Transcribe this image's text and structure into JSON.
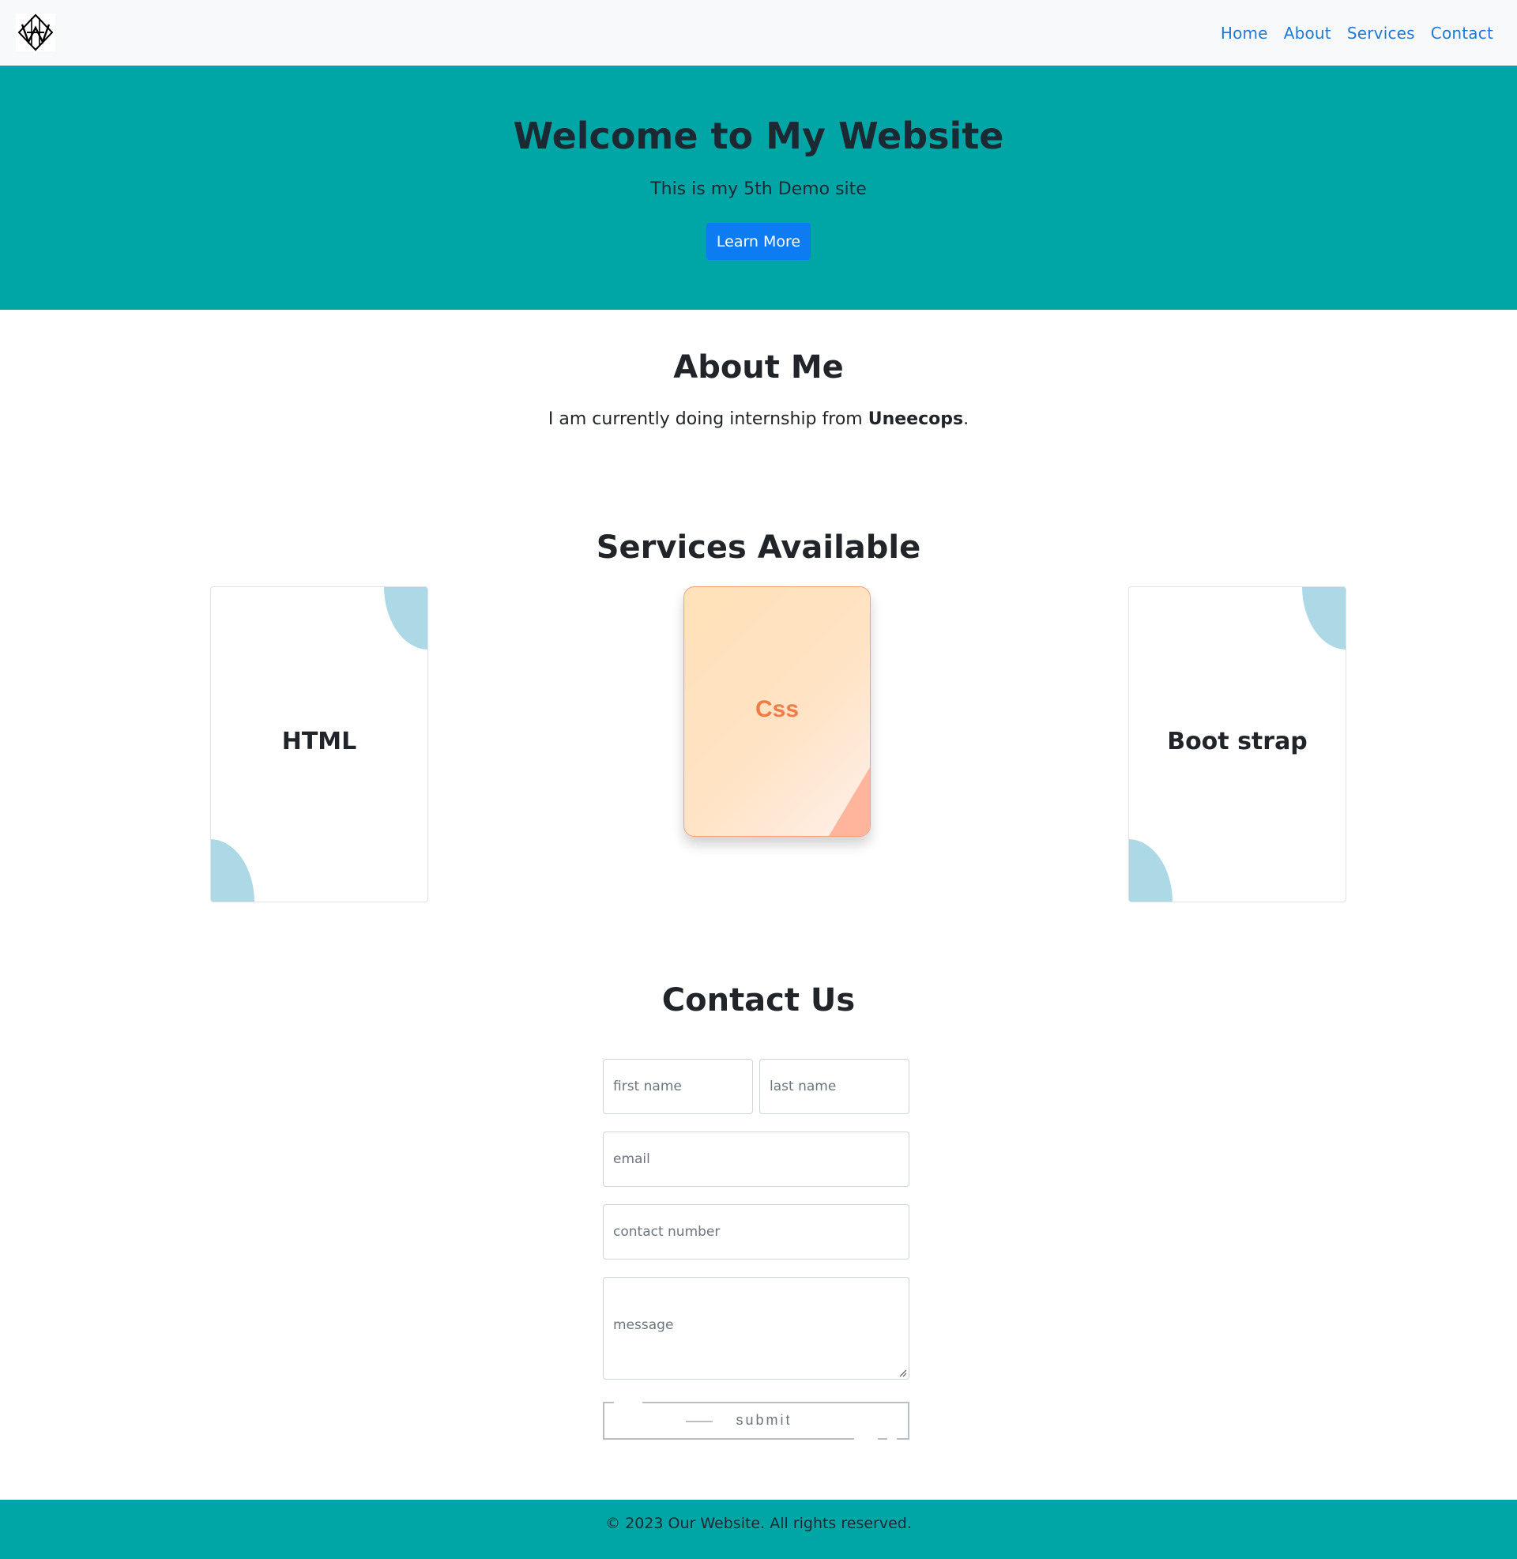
{
  "nav": {
    "logo_icon": "wh-monogram-logo",
    "links": [
      {
        "label": "Home"
      },
      {
        "label": "About"
      },
      {
        "label": "Services"
      },
      {
        "label": "Contact"
      }
    ]
  },
  "hero": {
    "title": "Welcome to My Website",
    "subtitle": "This is my 5th Demo site",
    "button_label": "Learn More"
  },
  "about": {
    "title": "About Me",
    "text_before": "I am currently doing internship from ",
    "text_bold": "Uneecops",
    "text_after": "."
  },
  "services": {
    "title": "Services Available",
    "cards": [
      {
        "label": "HTML"
      },
      {
        "label": "Css"
      },
      {
        "label": "Boot strap"
      }
    ]
  },
  "contact": {
    "title": "Contact Us",
    "first_name_placeholder": "first name",
    "last_name_placeholder": "last name",
    "email_placeholder": "email",
    "phone_placeholder": "contact number",
    "message_placeholder": "message",
    "submit_label": "submit"
  },
  "footer": {
    "text": "© 2023 Our Website. All rights reserved."
  },
  "colors": {
    "hero_bg": "#00a6a6",
    "nav_link": "#1f7ad6",
    "primary_button": "#0d7cf2",
    "card_blob": "#add8e6",
    "css_label": "#f07b46"
  }
}
